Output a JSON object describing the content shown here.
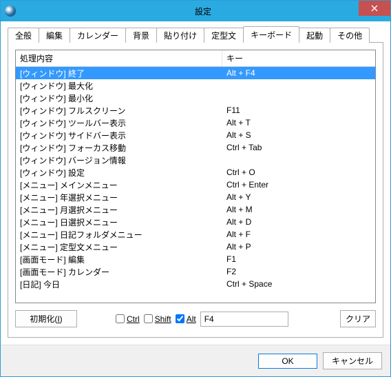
{
  "window": {
    "title": "設定"
  },
  "tabs": [
    {
      "label": "全般"
    },
    {
      "label": "編集"
    },
    {
      "label": "カレンダー"
    },
    {
      "label": "背景"
    },
    {
      "label": "貼り付け"
    },
    {
      "label": "定型文"
    },
    {
      "label": "キーボード"
    },
    {
      "label": "起動"
    },
    {
      "label": "その他"
    }
  ],
  "active_tab_index": 6,
  "columns": {
    "action": "処理内容",
    "key": "キー"
  },
  "rows": [
    {
      "action": "[ウィンドウ] 終了",
      "key": "Alt + F4",
      "selected": true
    },
    {
      "action": "[ウィンドウ] 最大化",
      "key": ""
    },
    {
      "action": "[ウィンドウ] 最小化",
      "key": ""
    },
    {
      "action": "[ウィンドウ] フルスクリーン",
      "key": "F11"
    },
    {
      "action": "[ウィンドウ] ツールバー表示",
      "key": "Alt + T"
    },
    {
      "action": "[ウィンドウ] サイドバー表示",
      "key": "Alt + S"
    },
    {
      "action": "[ウィンドウ] フォーカス移動",
      "key": "Ctrl + Tab"
    },
    {
      "action": "[ウィンドウ] バージョン情報",
      "key": ""
    },
    {
      "action": "[ウィンドウ] 設定",
      "key": "Ctrl + O"
    },
    {
      "action": "[メニュー] メインメニュー",
      "key": "Ctrl + Enter"
    },
    {
      "action": "[メニュー] 年選択メニュー",
      "key": "Alt + Y"
    },
    {
      "action": "[メニュー] 月選択メニュー",
      "key": "Alt + M"
    },
    {
      "action": "[メニュー] 日選択メニュー",
      "key": "Alt + D"
    },
    {
      "action": "[メニュー] 日記フォルダメニュー",
      "key": "Alt + F"
    },
    {
      "action": "[メニュー] 定型文メニュー",
      "key": "Alt + P"
    },
    {
      "action": "[画面モード] 編集",
      "key": "F1"
    },
    {
      "action": "[画面モード] カレンダー",
      "key": "F2"
    },
    {
      "action": "[日記] 今日",
      "key": "Ctrl + Space"
    }
  ],
  "editbar": {
    "init_prefix": "初期化(",
    "init_key": "I",
    "init_suffix": ")",
    "ctrl_label": "Ctrl",
    "ctrl_checked": false,
    "shift_label": "Shift",
    "shift_checked": false,
    "alt_label": "Alt",
    "alt_checked": true,
    "key_value": "F4",
    "clear": "クリア"
  },
  "dialog": {
    "ok": "OK",
    "cancel": "キャンセル"
  }
}
